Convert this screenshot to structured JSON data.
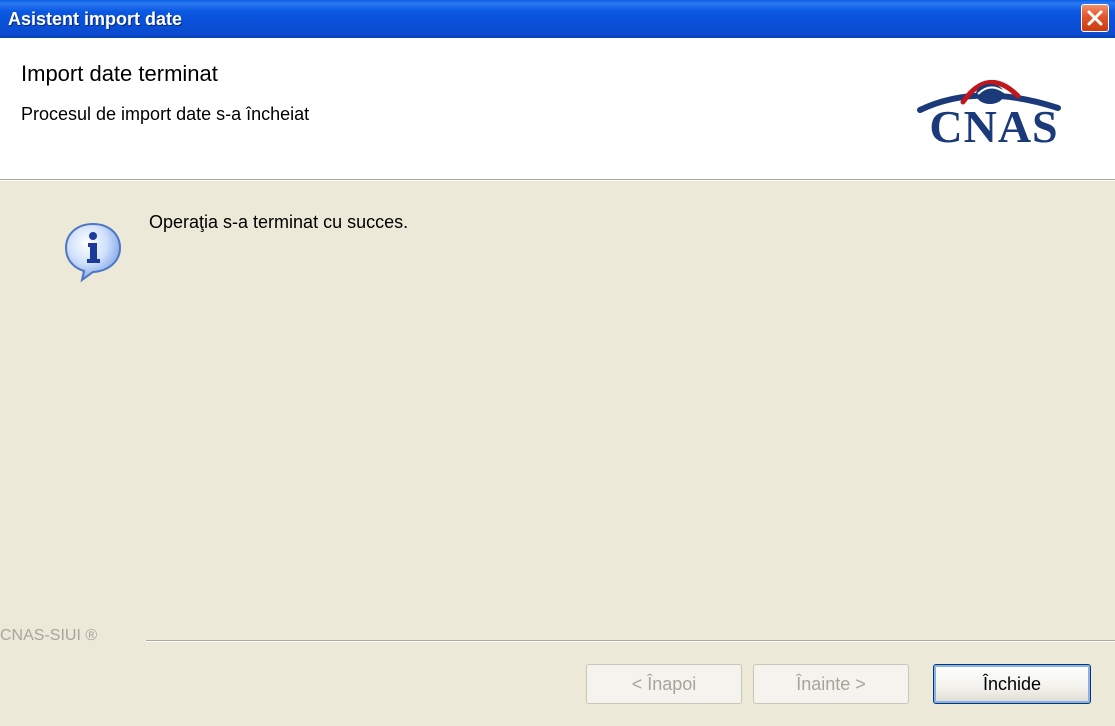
{
  "window": {
    "title": "Asistent import date",
    "close_icon": "close-icon"
  },
  "header": {
    "title": "Import date terminat",
    "subtitle": "Procesul de import date s-a încheiat",
    "logo_text": "CNAS"
  },
  "content": {
    "icon": "info-icon",
    "message": "Operaţia s-a terminat cu succes."
  },
  "footer": {
    "brand": "CNAS-SIUI ®",
    "buttons": {
      "back": "< Înapoi",
      "next": "Înainte >",
      "close": "Închide"
    }
  },
  "colors": {
    "titlebar": "#0a4fd6",
    "dialog_bg": "#ece9d8",
    "logo_blue": "#1b3a7a",
    "logo_red": "#c0161c"
  }
}
